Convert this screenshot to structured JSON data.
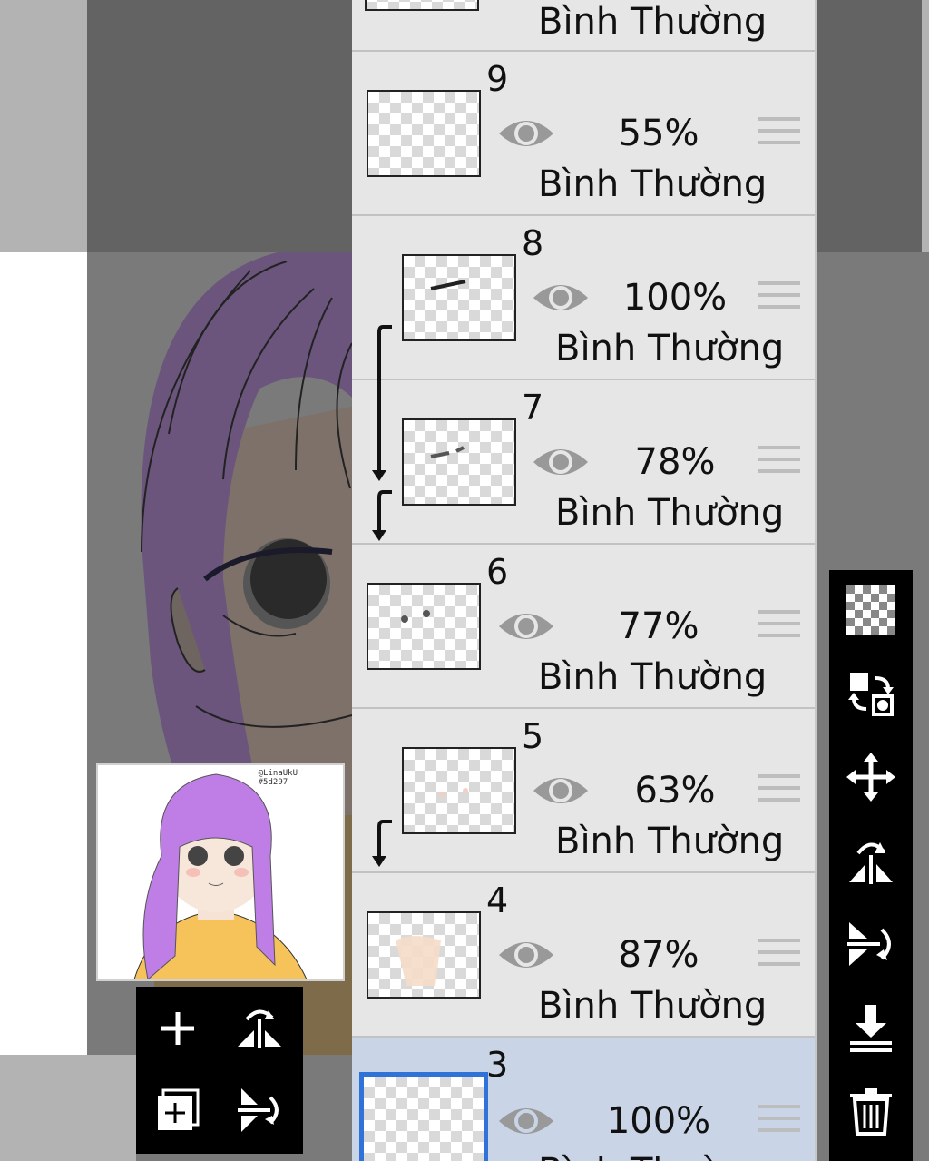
{
  "layers": [
    {
      "number": "",
      "opacity": "",
      "blend_mode": "Bình Thường"
    },
    {
      "number": "9",
      "opacity": "55%",
      "blend_mode": "Bình Thường"
    },
    {
      "number": "8",
      "opacity": "100%",
      "blend_mode": "Bình Thường"
    },
    {
      "number": "7",
      "opacity": "78%",
      "blend_mode": "Bình Thường"
    },
    {
      "number": "6",
      "opacity": "77%",
      "blend_mode": "Bình Thường"
    },
    {
      "number": "5",
      "opacity": "63%",
      "blend_mode": "Bình Thường"
    },
    {
      "number": "4",
      "opacity": "87%",
      "blend_mode": "Bình Thường"
    },
    {
      "number": "3",
      "opacity": "100%",
      "blend_mode": "Bình Thường"
    }
  ],
  "preview": {
    "watermark_line1": "@LinaUkU",
    "watermark_line2": "#5d297"
  },
  "toolbar_icons": [
    "transparency-checker-icon",
    "swap-layers-icon",
    "move-icon",
    "flip-horizontal-icon",
    "flip-vertical-icon",
    "merge-down-icon",
    "trash-icon"
  ],
  "mini_toolbar_icons": [
    "add-layer-icon",
    "flip-horizontal-icon",
    "add-copy-icon",
    "flip-vertical-icon"
  ],
  "colors": {
    "selected_row": "#c9d5e6",
    "selected_border": "#2f72d8",
    "hair": "#b57bdc",
    "shirt": "#f6c25a"
  }
}
